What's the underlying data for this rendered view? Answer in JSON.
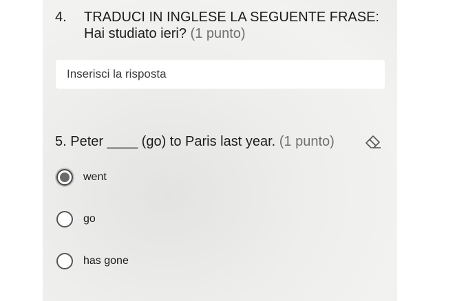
{
  "question4": {
    "number": "4.",
    "title_line1": "TRADUCI IN INGLESE LA SEGUENTE FRASE:",
    "title_line2": "Hai studiato ieri?",
    "points": "(1 punto)",
    "answer_placeholder": "Inserisci la risposta"
  },
  "question5": {
    "number": "5.",
    "text": "Peter ____ (go) to Paris last year.",
    "points": "(1 punto)",
    "clear_icon": "eraser-icon",
    "options": [
      {
        "label": "went",
        "selected": true
      },
      {
        "label": "go",
        "selected": false
      },
      {
        "label": "has gone",
        "selected": false
      }
    ]
  }
}
